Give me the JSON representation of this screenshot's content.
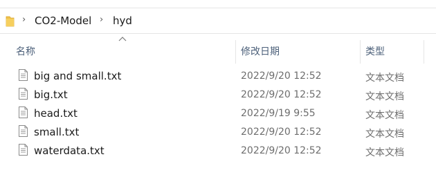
{
  "address_bar": {
    "crumbs": [
      {
        "label": "CO2-Model"
      },
      {
        "label": "hyd"
      }
    ],
    "separator": "›"
  },
  "columns": {
    "name": "名称",
    "date_modified": "修改日期",
    "type": "类型"
  },
  "sort": {
    "column": "name",
    "icon": "sort-ascending-icon"
  },
  "files": [
    {
      "name": "big and small.txt",
      "date_modified": "2022/9/20 12:52",
      "type": "文本文档",
      "icon": "text-file-icon"
    },
    {
      "name": "big.txt",
      "date_modified": "2022/9/20 12:52",
      "type": "文本文档",
      "icon": "text-file-icon"
    },
    {
      "name": "head.txt",
      "date_modified": "2022/9/19 9:55",
      "type": "文本文档",
      "icon": "text-file-icon"
    },
    {
      "name": "small.txt",
      "date_modified": "2022/9/20 12:52",
      "type": "文本文档",
      "icon": "text-file-icon"
    },
    {
      "name": "waterdata.txt",
      "date_modified": "2022/9/20 12:52",
      "type": "文本文档",
      "icon": "text-file-icon"
    }
  ],
  "colors": {
    "folder": "#f0c14b",
    "header_text": "#4c607a",
    "meta_text": "#6d6d6d"
  }
}
